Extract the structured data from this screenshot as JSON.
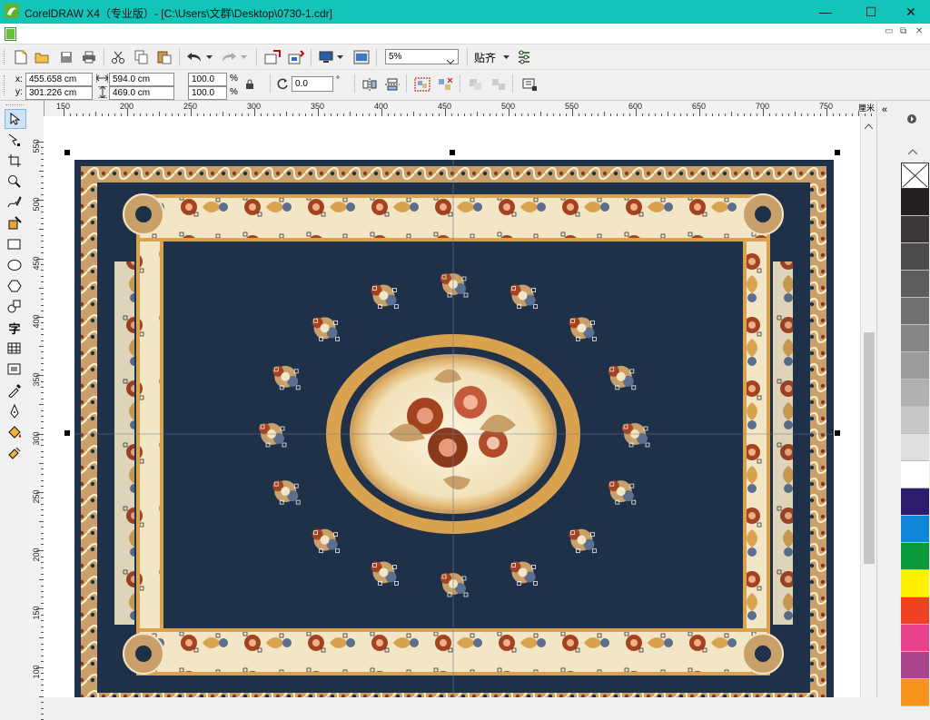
{
  "window": {
    "title": "CorelDRAW X4（专业版）- [C:\\Users\\文群\\Desktop\\0730-1.cdr]",
    "minimize_glyph": "—",
    "maximize_glyph": "☐",
    "close_glyph": "✕",
    "accent_color": "#15c4b8"
  },
  "menubar": {
    "doc_minimize": "▭",
    "doc_restore": "⧉",
    "doc_close": "✕"
  },
  "toolbar": {
    "zoom_value": "5%",
    "snap_label": "贴齐",
    "icons": [
      "new-icon",
      "open-icon",
      "save-icon",
      "print-icon",
      "cut-icon",
      "copy-icon",
      "paste-icon",
      "undo-icon",
      "redo-icon",
      "import-icon",
      "export-icon",
      "application-launcher-icon",
      "welcome-screen-icon",
      "options-icon"
    ]
  },
  "property_bar": {
    "x_label": "x:",
    "y_label": "y:",
    "x_value": "455.658 cm",
    "y_value": "301.226 cm",
    "width_value": "594.0 cm",
    "height_value": "469.0 cm",
    "scale_x": "100.0",
    "scale_y": "100.0",
    "percent_symbol": "%",
    "rotation_value": "0.0",
    "degree_symbol": "°"
  },
  "ruler": {
    "unit": "厘米",
    "h_labels": [
      "150",
      "200",
      "250",
      "300",
      "350",
      "400",
      "450",
      "500",
      "550",
      "600",
      "650",
      "700",
      "750"
    ],
    "v_labels": [
      "550",
      "500",
      "450",
      "400",
      "350",
      "300",
      "250",
      "200",
      "150",
      "100"
    ]
  },
  "toolbox": {
    "tools": [
      "pick-tool-icon",
      "shape-tool-icon",
      "crop-tool-icon",
      "zoom-tool-icon",
      "freehand-tool-icon",
      "smart-fill-icon",
      "rectangle-tool-icon",
      "ellipse-tool-icon",
      "polygon-tool-icon",
      "basic-shapes-icon",
      "text-tool-icon",
      "table-tool-icon",
      "interactive-blend-icon",
      "eyedropper-icon",
      "outline-pen-icon",
      "fill-tool-icon",
      "interactive-fill-icon"
    ],
    "text_tool_glyph": "字"
  },
  "palette": {
    "colors": [
      "#231f20",
      "#3a3637",
      "#4d4a4b",
      "#5f5c5d",
      "#737071",
      "#878586",
      "#9c9a9b",
      "#b2b0b1",
      "#c9c8c8",
      "#e0dfdf",
      "#ffffff",
      "#2e1a6e",
      "#0f86d6",
      "#0a9a3c",
      "#fff100",
      "#ef4123",
      "#e8418c",
      "#a8448c",
      "#f7941d"
    ]
  },
  "document": {
    "carpet_navy": "#1f3049",
    "carpet_cream": "#f3e6c6",
    "carpet_gold": "#d9a24f",
    "carpet_rust": "#a3431f"
  }
}
